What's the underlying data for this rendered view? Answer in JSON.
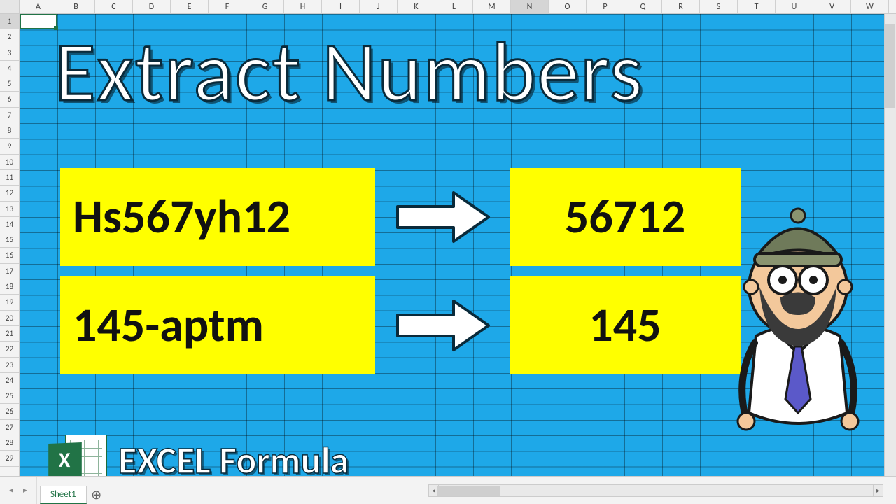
{
  "columns": [
    "A",
    "B",
    "C",
    "D",
    "E",
    "F",
    "G",
    "H",
    "I",
    "J",
    "K",
    "L",
    "M",
    "N",
    "O",
    "P",
    "Q",
    "R",
    "S",
    "T",
    "U",
    "V",
    "W"
  ],
  "active_column_index": 13,
  "rows": [
    "1",
    "2",
    "3",
    "4",
    "5",
    "6",
    "7",
    "8",
    "9",
    "10",
    "11",
    "12",
    "13",
    "14",
    "15",
    "16",
    "17",
    "18",
    "19",
    "20",
    "21",
    "22",
    "23",
    "24",
    "25",
    "26",
    "27",
    "28",
    "29"
  ],
  "active_row_index": 0,
  "title": "Extract Numbers",
  "examples": [
    {
      "input": "Hs567yh12",
      "output": "56712"
    },
    {
      "input": "145-aptm",
      "output": "145"
    }
  ],
  "footer_label": "EXCEL Formula",
  "excel_badge_letter": "X",
  "sheet_tab": "Sheet1",
  "add_sheet_glyph": "⊕",
  "nav_prev": "◂",
  "nav_next": "▸",
  "scroll_left": "◂",
  "scroll_right": "▸"
}
